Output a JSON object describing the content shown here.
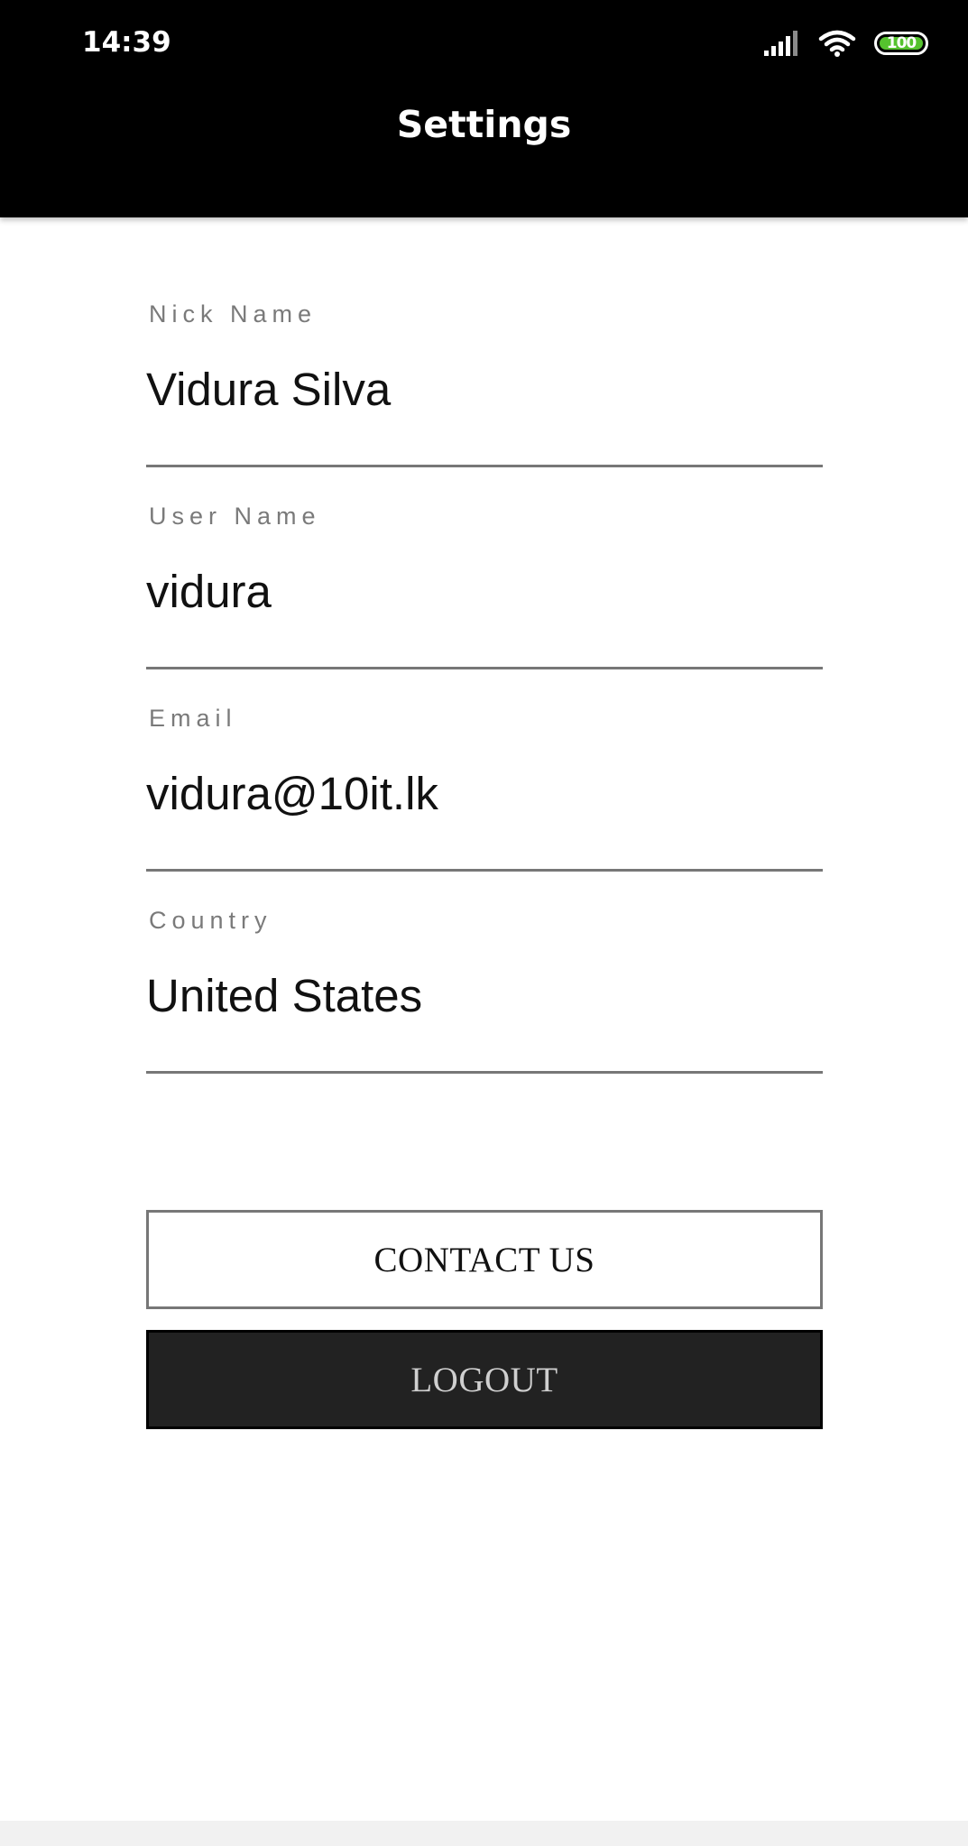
{
  "status_bar": {
    "time": "14:39",
    "battery_level": "100",
    "signal_icon": "cell-signal-icon",
    "wifi_icon": "wifi-icon",
    "battery_icon": "battery-icon",
    "battery_color": "#55c22e"
  },
  "header": {
    "title": "Settings"
  },
  "fields": [
    {
      "label": "Nick Name",
      "value": "Vidura Silva"
    },
    {
      "label": "User Name",
      "value": "vidura"
    },
    {
      "label": "Email",
      "value": "vidura@10it.lk"
    },
    {
      "label": "Country",
      "value": "United States"
    }
  ],
  "buttons": {
    "contact_label": "CONTACT US",
    "logout_label": "LOGOUT"
  }
}
